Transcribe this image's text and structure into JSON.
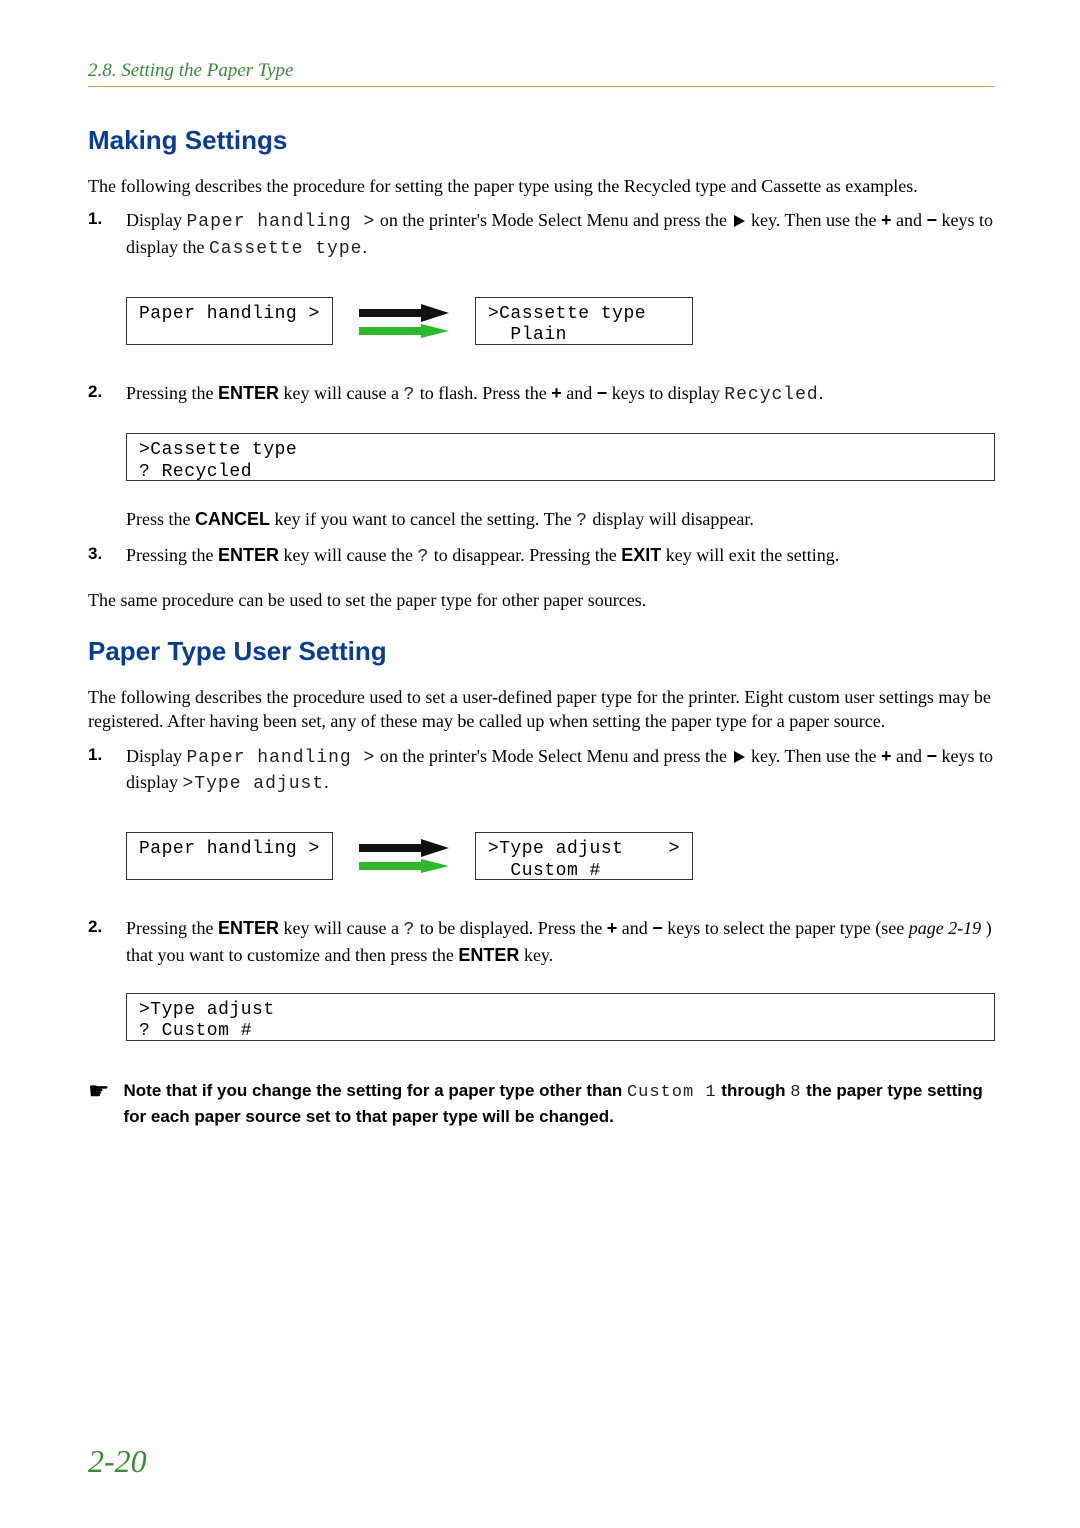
{
  "header": "2.8.  Setting the Paper Type",
  "section1": {
    "title": "Making Settings",
    "intro": "The following describes the procedure for setting the paper type using the Recycled type and Cassette as examples.",
    "step1": {
      "num": "1.",
      "t1": "Display ",
      "lcd1": "Paper handling >",
      "t2": " on the printer's Mode Select Menu and press the ",
      "t3": " key. Then use the ",
      "plus": "+",
      "t4": " and ",
      "minus": "−",
      "t5": " keys to display the ",
      "lcd2": "Cassette type",
      "t6": "."
    },
    "diag1": {
      "boxA": "Paper handling >",
      "boxB": ">Cassette type\n  Plain"
    },
    "step2": {
      "num": "2.",
      "t1": "Pressing the ",
      "k1": "ENTER",
      "t2": " key will cause a ",
      "q": "?",
      "t3": " to flash. Press the ",
      "plus": "+",
      "t4": " and ",
      "minus": "−",
      "t5": " keys to display ",
      "lcd": "Recycled",
      "t6": "."
    },
    "diag2": {
      "box": ">Cassette type\n? Recycled"
    },
    "step2b": {
      "t1": "Press the ",
      "k1": "CANCEL",
      "t2": " key if you want to cancel the setting. The ",
      "q": "?",
      "t3": " display will disappear."
    },
    "step3": {
      "num": "3.",
      "t1": "Pressing the ",
      "k1": "ENTER",
      "t2": " key will cause the ",
      "q": "?",
      "t3": " to disappear. Pressing the ",
      "k2": "EXIT",
      "t4": " key will exit the setting."
    },
    "outro": "The same procedure can be used to set the paper type for other paper sources."
  },
  "section2": {
    "title": "Paper Type User Setting",
    "intro": "The following describes the procedure used to set a user-defined paper type for the printer. Eight custom user settings may be registered. After having been set, any of these may be called up when setting the paper type for a paper source.",
    "step1": {
      "num": "1.",
      "t1": "Display ",
      "lcd1": "Paper handling >",
      "t2": " on the printer's Mode Select Menu and press the ",
      "t3": " key. Then use the ",
      "plus": "+",
      "t4": " and ",
      "minus": "−",
      "t5": " keys to display ",
      "lcd2": ">Type adjust",
      "t6": "."
    },
    "diag1": {
      "boxA": "Paper handling >",
      "boxB": ">Type adjust    >\n  Custom #"
    },
    "step2": {
      "num": "2.",
      "t1": "Pressing the ",
      "k1": "ENTER",
      "t2": " key will cause a ",
      "q": "?",
      "t3": " to be displayed. Press the ",
      "plus": "+",
      "t4": " and ",
      "minus": "−",
      "t5": " keys to select the paper type (see ",
      "pageref": "page 2-19",
      "t6": " ) that you want to customize and then press the ",
      "k2": "ENTER",
      "t7": " key."
    },
    "diag2": {
      "box": ">Type adjust\n? Custom #"
    },
    "note": {
      "t1": "Note that if you change the setting for a paper type other than ",
      "lcd1": "Custom 1",
      "t2": " through ",
      "lcd2": "8",
      "t3": " the paper type setting for each paper source set to that paper type will be changed."
    }
  },
  "pageNumber": "2-20"
}
